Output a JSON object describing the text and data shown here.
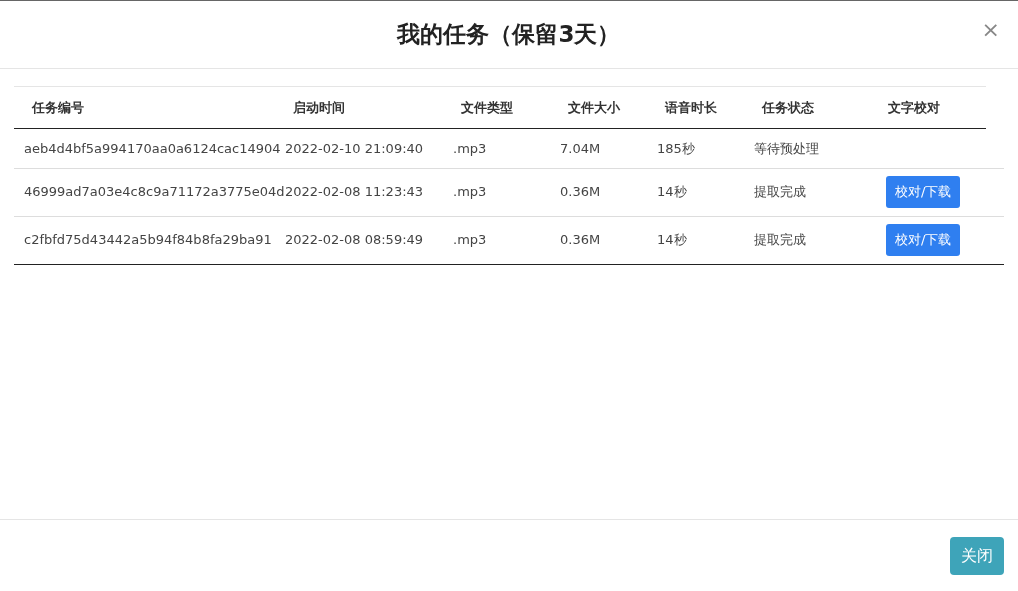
{
  "dialog": {
    "title": "我的任务（保留3天）",
    "close_icon": "×"
  },
  "table": {
    "columns": [
      "任务编号",
      "启动时间",
      "文件类型",
      "文件大小",
      "语音时长",
      "任务状态",
      "文字校对"
    ],
    "rows": [
      {
        "cells": [
          "aeb4d4bf5a994170aa0a6124cac14904",
          "2022-02-10 21:09:40",
          ".mp3",
          "7.04M",
          "185秒",
          "等待预处理"
        ]
      },
      {
        "cells": [
          "46999ad7a03e4c8c9a71172a3775e04d",
          "2022-02-08 11:23:43",
          ".mp3",
          "0.36M",
          "14秒",
          "提取完成"
        ],
        "action": "校对/下载"
      },
      {
        "cells": [
          "c2fbfd75d43442a5b94f84b8fa29ba91",
          "2022-02-08 08:59:49",
          ".mp3",
          "0.36M",
          "14秒",
          "提取完成"
        ],
        "action": "校对/下载"
      }
    ]
  },
  "footer": {
    "close_button": "关闭"
  }
}
